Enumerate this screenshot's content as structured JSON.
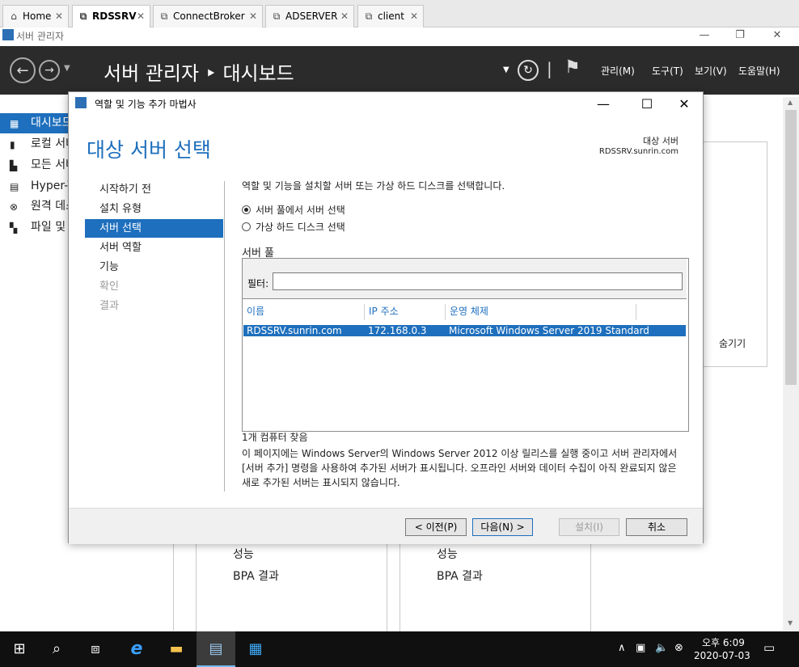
{
  "browser": {
    "tabs": [
      {
        "label": "Home",
        "icon": "home-icon"
      },
      {
        "label": "RDSSRV",
        "icon": "remote-desktop-icon",
        "active": true
      },
      {
        "label": "ConnectBroker",
        "icon": "remote-desktop-icon"
      },
      {
        "label": "ADSERVER",
        "icon": "remote-desktop-icon"
      },
      {
        "label": "client",
        "icon": "remote-desktop-icon"
      }
    ],
    "close_glyph": "✕"
  },
  "window": {
    "title": "서버 관리자",
    "minimize": "—",
    "restore": "❐",
    "close": "✕"
  },
  "server_manager": {
    "title": "서버 관리자 ‣ 대시보드",
    "menu": [
      "관리(M)",
      "도구(T)",
      "보기(V)",
      "도움말(H)"
    ],
    "nav": [
      {
        "label": "대시보드",
        "icon": "dashboard-icon"
      },
      {
        "label": "로컬 서버",
        "icon": "local-server-icon"
      },
      {
        "label": "모든 서버",
        "icon": "all-servers-icon"
      },
      {
        "label": "Hyper-V",
        "icon": "hyper-v-icon"
      },
      {
        "label": "원격 데스크톱 서비스",
        "icon": "remote-desktop-services-icon"
      },
      {
        "label": "파일 및 저장소 서비스",
        "icon": "file-storage-icon"
      }
    ],
    "hide_label": "숨기기",
    "tiles": [
      {
        "performance": "성능",
        "bpa": "BPA 결과"
      },
      {
        "performance": "성능",
        "bpa": "BPA 결과"
      }
    ]
  },
  "dialog": {
    "title": "역할 및 기능 추가 마법사",
    "heading": "대상 서버 선택",
    "destination_label": "대상 서버",
    "destination_server": "RDSSRV.sunrin.com",
    "steps": [
      {
        "label": "시작하기 전",
        "state": "normal"
      },
      {
        "label": "설치 유형",
        "state": "normal"
      },
      {
        "label": "서버 선택",
        "state": "selected"
      },
      {
        "label": "서버 역할",
        "state": "normal"
      },
      {
        "label": "기능",
        "state": "normal"
      },
      {
        "label": "확인",
        "state": "disabled"
      },
      {
        "label": "결과",
        "state": "disabled"
      }
    ],
    "description": "역할 및 기능을 설치할 서버 또는 가상 하드 디스크를 선택합니다.",
    "radio_pool": "서버 풀에서 서버 선택",
    "radio_vhd": "가상 하드 디스크 선택",
    "pool_label": "서버 풀",
    "filter_label": "필터:",
    "filter_value": "",
    "columns": [
      "이름",
      "IP 주소",
      "운영 체제"
    ],
    "rows": [
      {
        "name": "RDSSRV.sunrin.com",
        "ip": "172.168.0.3",
        "os": "Microsoft Windows Server 2019 Standard"
      }
    ],
    "found": "1개 컴퓨터 찾음",
    "note": "이 페이지에는 Windows Server의 Windows Server 2012 이상 릴리스를 실행 중이고 서버 관리자에서 [서버 추가] 명령을 사용하여 추가된 서버가 표시됩니다. 오프라인 서버와 데이터 수집이 아직 완료되지 않은 새로 추가된 서버는 표시되지 않습니다.",
    "buttons": {
      "prev": "< 이전(P)",
      "next": "다음(N) >",
      "install": "설치(I)",
      "cancel": "취소"
    }
  },
  "taskbar": {
    "time": "오후 6:09",
    "date": "2020-07-03"
  }
}
